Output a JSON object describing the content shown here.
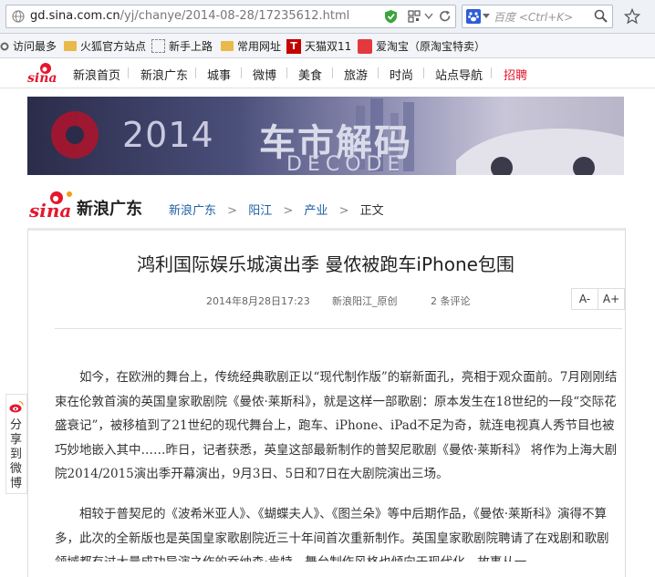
{
  "browser": {
    "url_domain": "gd.sina.com.cn",
    "url_path": "/yj/chanye/2014-08-28/17235612.html",
    "search_engine": "百度",
    "search_placeholder": "百度 <Ctrl+K>"
  },
  "bookmarks": [
    "访问最多",
    "火狐官方站点",
    "新手上路",
    "常用网址",
    "天猫双11",
    "爱淘宝（原淘宝特卖）"
  ],
  "nav": {
    "logo": "sina",
    "items": [
      "新浪首页",
      "新浪广东",
      "城事",
      "微博",
      "美食",
      "旅游",
      "时尚",
      "站点导航",
      "招聘"
    ]
  },
  "banner": {
    "year": "2014",
    "title": "车市解码",
    "subtitle": "DECODE"
  },
  "header": {
    "logo_text": "sina",
    "channel": "新浪广东",
    "breadcrumb": [
      "新浪广东",
      "阳江",
      "产业",
      "正文"
    ]
  },
  "article": {
    "title": "鸿利国际娱乐城演出季 曼侬被跑车iPhone包围",
    "date": "2014年8月28日17:23",
    "source": "新浪阳江_原创",
    "comments": "2 条评论",
    "font_smaller": "A-",
    "font_larger": "A+",
    "paragraphs": [
      "如今，在欧洲的舞台上，传统经典歌剧正以“现代制作版”的崭新面孔，亮相于观众面前。7月刚刚结束在伦敦首演的英国皇家歌剧院《曼侬·莱斯科》，就是这样一部歌剧：原本发生在18世纪的一段“交际花盛衰记”，被移植到了21世纪的现代舞台上，跑车、iPhone、iPad不足为奇，就连电视真人秀节目也被巧妙地嵌入其中……昨日，记者获悉，英皇这部最新制作的普契尼歌剧《曼侬·莱斯科》 将作为上海大剧院2014/2015演出季开幕演出，9月3日、5日和7日在大剧院演出三场。",
      "相较于普契尼的《波希米亚人》、《蝴蝶夫人》、《图兰朵》等中后期作品，《曼侬·莱斯科》演得不算多，此次的全新版也是英国皇家歌剧院近三十年间首次重新制作。英国皇家歌剧院聘请了在戏剧和歌剧领域都有过大量成功导演之作的乔纳森·肯特，舞台制作风格也倾向于现代化，故事从一"
    ]
  },
  "share": {
    "label": "分享到微博"
  }
}
